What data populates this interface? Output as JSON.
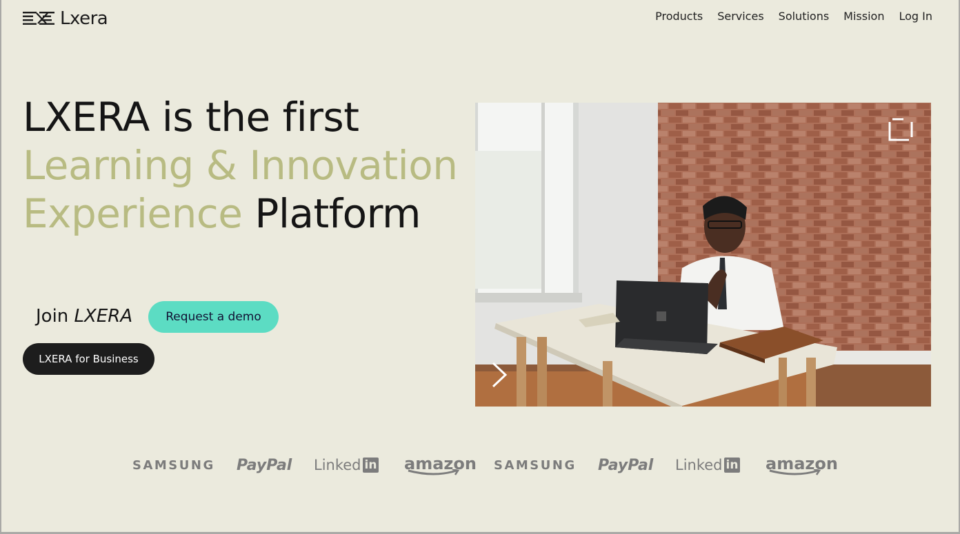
{
  "header": {
    "brand_name": "Lxera",
    "nav": [
      "Products",
      "Services",
      "Solutions",
      "Mission",
      "Log In"
    ]
  },
  "hero": {
    "headline_part1": "LXERA is the first",
    "headline_accent_line": "Learning & Innovation",
    "headline_accent_word": "Experience",
    "headline_end": " Platform",
    "join_prefix": "Join ",
    "join_brand": "LXERA",
    "demo_button": "Request a demo",
    "business_button": "LXERA for Business"
  },
  "hero_image": {
    "subject": "man-at-desk-with-laptop",
    "icons": [
      "next-arrow-icon",
      "expand-icon"
    ]
  },
  "partner_logos": [
    {
      "name": "SAMSUNG",
      "type": "samsung"
    },
    {
      "name": "PayPal",
      "type": "paypal"
    },
    {
      "name": "Linked",
      "badge": "in",
      "type": "linkedin"
    },
    {
      "name": "amazon",
      "type": "amazon"
    },
    {
      "name": "SAMSUNG",
      "type": "samsung"
    },
    {
      "name": "PayPal",
      "type": "paypal"
    },
    {
      "name": "Linked",
      "badge": "in",
      "type": "linkedin"
    },
    {
      "name": "amazon",
      "type": "amazon"
    }
  ],
  "colors": {
    "background": "#ebeadd",
    "accent_text": "#b8bb82",
    "demo_button": "#5cdcc3",
    "business_button": "#1d1d1d",
    "logo_gray": "#7c7c7c"
  }
}
